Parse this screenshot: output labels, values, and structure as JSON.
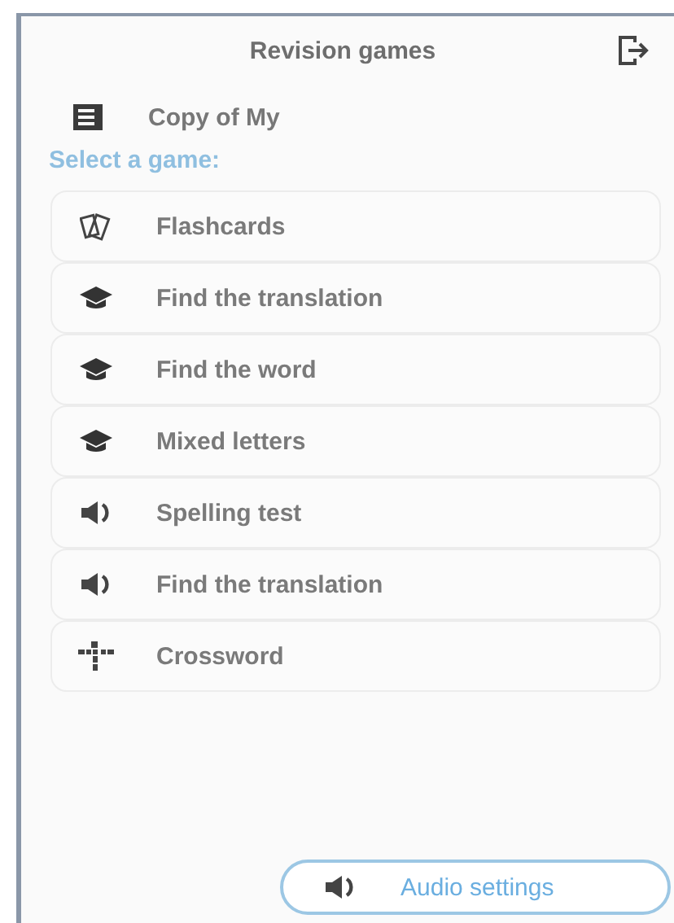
{
  "header": {
    "title": "Revision games"
  },
  "list_name": "Copy of My",
  "section_label": "Select a game:",
  "games": [
    {
      "kind": "cards",
      "label": "Flashcards"
    },
    {
      "kind": "quiz",
      "label": "Find the translation"
    },
    {
      "kind": "quiz",
      "label": "Find the word"
    },
    {
      "kind": "quiz",
      "label": "Mixed letters"
    },
    {
      "kind": "audio",
      "label": "Spelling test"
    },
    {
      "kind": "audio",
      "label": "Find the translation"
    },
    {
      "kind": "crossword",
      "label": "Crossword"
    }
  ],
  "audio_button": {
    "label": "Audio settings"
  }
}
